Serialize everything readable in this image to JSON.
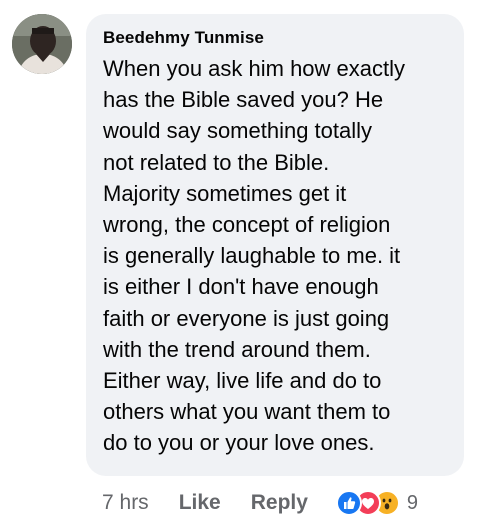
{
  "comment": {
    "author": "Beedehmy Tunmise",
    "text": "When you ask him how  exactly\nhas the Bible saved you?  He\nwould  say something  totally\nnot related to the  Bible.\nMajority  sometimes  get it\nwrong, the concept  of religion\nis  generally  laughable  to me. it\nis either  I don't  have enough\nfaith  or everyone  is just going\nwith the trend around  them.\nEither  way, live life and do to\nothers  what you  want  them  to\ndo to you or your love  ones."
  },
  "actions": {
    "time": "7 hrs",
    "like_label": "Like",
    "reply_label": "Reply",
    "reactions": [
      "like-icon",
      "love-icon",
      "wow-icon"
    ],
    "reaction_count": "9"
  },
  "colors": {
    "bubble_bg": "#f0f2f5",
    "meta_text": "#65676b",
    "like_blue": "#1877f2",
    "love_red": "#f33e58",
    "wow_yellow": "#f7b125"
  }
}
